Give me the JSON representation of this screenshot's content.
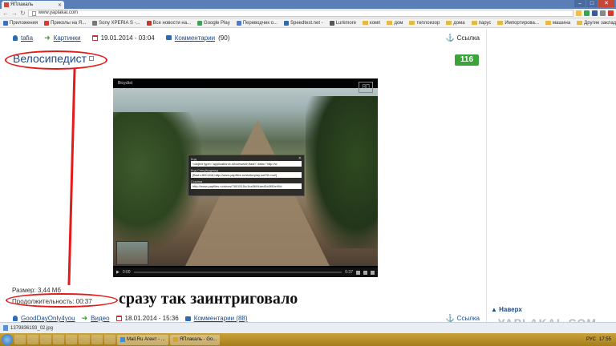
{
  "browser": {
    "tab_title": "ЯПлакаль",
    "url": "www.yaplakal.com",
    "window_controls": [
      "–",
      "□",
      "✕"
    ],
    "bookmarks": [
      {
        "label": "Приложения",
        "color": "#3b6fc4"
      },
      {
        "label": "Приколы на Я...",
        "color": "#d43a2f"
      },
      {
        "label": "Sony XPERIA S -...",
        "color": "#777777"
      },
      {
        "label": "Все новости на...",
        "color": "#c0392b"
      },
      {
        "label": "Google Play",
        "color": "#3aa35a"
      },
      {
        "label": "Переводчик о...",
        "color": "#4a7bd4"
      },
      {
        "label": "Speedtest.net -",
        "color": "#2a6db5"
      },
      {
        "label": "Lurkmore",
        "color": "#555555"
      },
      {
        "label": "комп",
        "color": "#e5b84c"
      },
      {
        "label": "дом",
        "color": "#e5b84c"
      },
      {
        "label": "теплоизор",
        "color": "#e5b84c"
      },
      {
        "label": "дома",
        "color": "#e5b84c"
      },
      {
        "label": "парус",
        "color": "#e5b84c"
      },
      {
        "label": "Импортирова...",
        "color": "#e5b84c"
      },
      {
        "label": "машина",
        "color": "#e5b84c"
      }
    ],
    "other_bookmarks": "Другие закладки"
  },
  "post": {
    "author": "tafia",
    "category": "Картинки",
    "date": "19.01.2014 - 03:04",
    "comments": "Комментарии",
    "comments_count": "(90)",
    "share": "Ссылка",
    "title": "Велосипедист",
    "rating": "116",
    "size": "Размер: 3,44 Мб",
    "duration": "Продолжительность: 00:37",
    "caption": "сразу так заинтриговало"
  },
  "player": {
    "title": "Bicyclist",
    "logo": "ЯП",
    "time": "0:00",
    "duration": "0:37",
    "progress": 0,
    "embed": {
      "label1": "Код",
      "value1": "<object type=\"application/x-shockwave-flash\" data=\"http://w",
      "label2": "Код СпецАндроид",
      "value2": "[flash=600,618,http://www.yapfiles.ru/static/play.swf?fl=nul/]",
      "label3": "Ссылка",
      "value3": "http://www.yapfiles.ru/show/7601515/c1ba3694ae46a3f50e90d"
    }
  },
  "next_post": {
    "author": "GoodDayOnly4you",
    "category": "Видео",
    "date": "18.01.2014 - 15:36",
    "comments": "Комментарии (88)",
    "share": "Ссылка"
  },
  "sidebar": {
    "next_label": "▲ Наверх"
  },
  "downloads": {
    "file": "1379836193_02.jpg"
  },
  "watermark": "YAPLAKAL.COM",
  "taskbar": {
    "tasks": [
      "Mail.Ru Агент - ...",
      "ЯПлакаль - Go..."
    ],
    "lang": "РУС",
    "time": "17:55"
  },
  "colors": {
    "link": "#1b4a8a",
    "rating_bg": "#3aa33a",
    "annotation": "#e41b1b"
  }
}
